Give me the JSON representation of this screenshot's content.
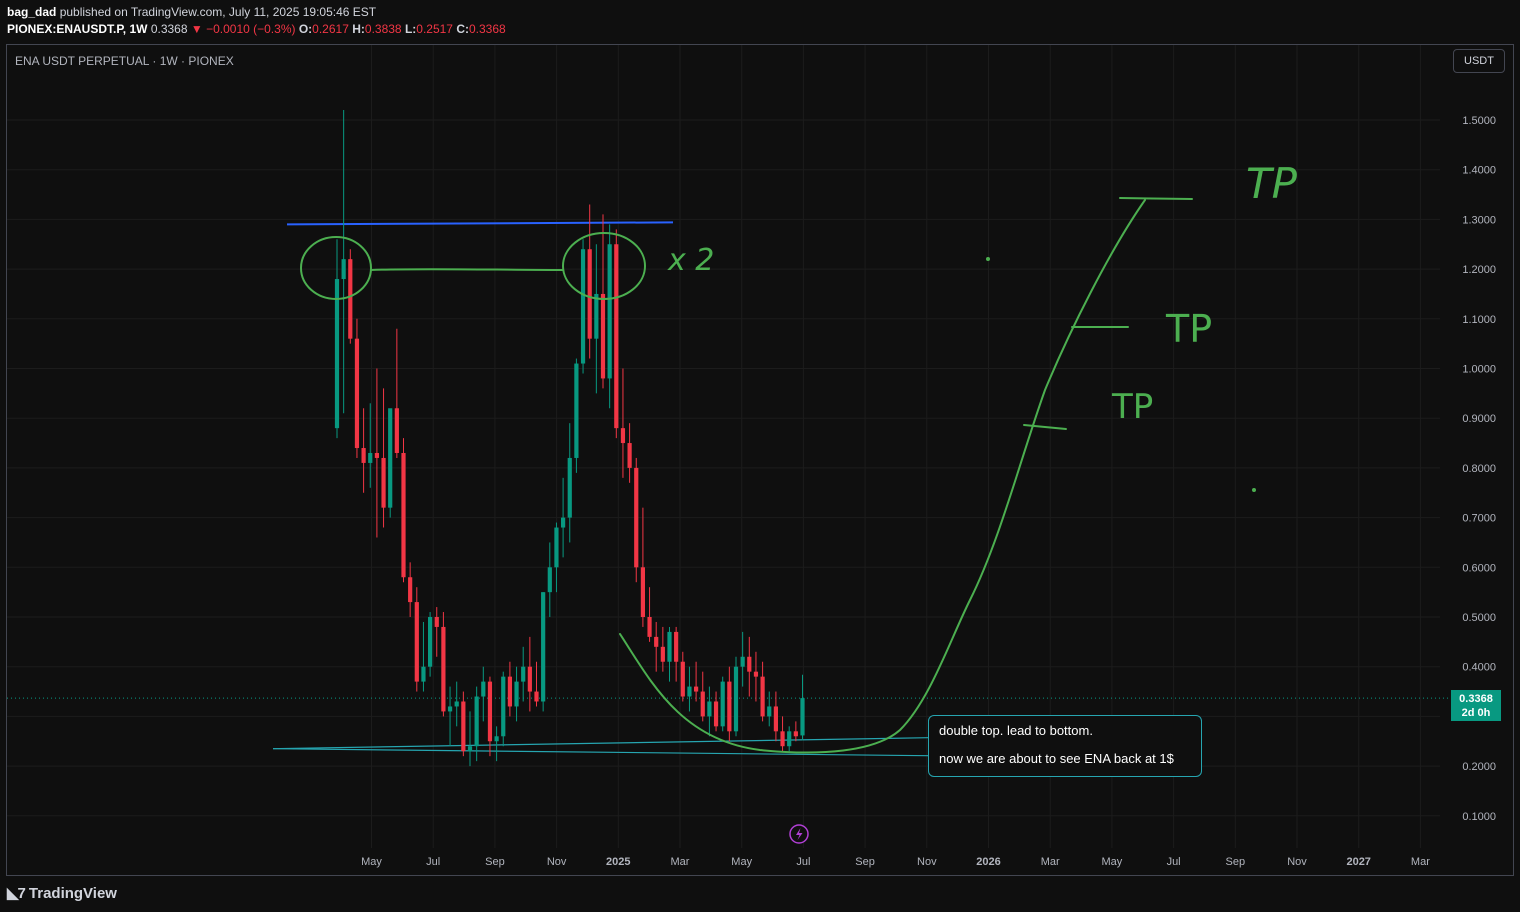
{
  "header": {
    "author": "bag_dad",
    "published": "published on TradingView.com, July 11, 2025 19:05:46 EST",
    "symbol": "PIONEX:ENAUSDT.P, 1W",
    "last": "0.3368",
    "change": "▼ −0.0010 (−0.3%)",
    "o_label": "O:",
    "o": "0.2617",
    "h_label": "H:",
    "h": "0.3838",
    "l_label": "L:",
    "l": "0.2517",
    "c_label": "C:",
    "c": "0.3368"
  },
  "chart_title": "ENA USDT PERPETUAL · 1W · PIONEX",
  "unit_button": "USDT",
  "price_tag": {
    "price": "0.3368",
    "countdown": "2d 0h"
  },
  "note": {
    "line1": "double top. lead to bottom.",
    "line2": "now we are about to see ENA back at 1$"
  },
  "drawings": {
    "x2_label": "x 2",
    "tp_labels": [
      "TP",
      "TP",
      "TP"
    ]
  },
  "footer": {
    "logo": "TradingView"
  },
  "colors": {
    "up": "#089981",
    "down": "#f23645",
    "background": "#0f0f0f",
    "grid": "#1c1c1c",
    "hand_drawn": "#4caf50",
    "resistance": "#2962ff",
    "support": "#26a5b0"
  },
  "chart_data": {
    "type": "candlestick",
    "title": "ENA USDT PERPETUAL · 1W · PIONEX",
    "y_ticks": [
      "0.1000",
      "0.2000",
      "0.3000",
      "0.4000",
      "0.5000",
      "0.6000",
      "0.7000",
      "0.8000",
      "0.9000",
      "1.0000",
      "1.1000",
      "1.2000",
      "1.3000",
      "1.4000",
      "1.5000"
    ],
    "x_ticks": [
      "May",
      "Jul",
      "Sep",
      "Nov",
      "2025",
      "Mar",
      "May",
      "Jul",
      "Sep",
      "Nov",
      "2026",
      "Mar",
      "May",
      "Jul",
      "Sep",
      "Nov",
      "2027",
      "Mar"
    ],
    "last_price": 0.3368,
    "grid": true,
    "resistance_level": 1.29,
    "support_level": 0.235,
    "candles": [
      {
        "o": 0.88,
        "h": 1.26,
        "l": 0.86,
        "c": 1.18
      },
      {
        "o": 1.18,
        "h": 1.52,
        "l": 0.91,
        "c": 1.22
      },
      {
        "o": 1.22,
        "h": 1.24,
        "l": 1.05,
        "c": 1.06
      },
      {
        "o": 1.06,
        "h": 1.1,
        "l": 0.82,
        "c": 0.84
      },
      {
        "o": 0.84,
        "h": 0.92,
        "l": 0.75,
        "c": 0.81
      },
      {
        "o": 0.81,
        "h": 0.93,
        "l": 0.76,
        "c": 0.83
      },
      {
        "o": 0.83,
        "h": 1.0,
        "l": 0.66,
        "c": 0.82
      },
      {
        "o": 0.82,
        "h": 0.96,
        "l": 0.68,
        "c": 0.72
      },
      {
        "o": 0.72,
        "h": 0.91,
        "l": 0.7,
        "c": 0.92
      },
      {
        "o": 0.92,
        "h": 1.08,
        "l": 0.82,
        "c": 0.83
      },
      {
        "o": 0.83,
        "h": 0.86,
        "l": 0.57,
        "c": 0.58
      },
      {
        "o": 0.58,
        "h": 0.61,
        "l": 0.5,
        "c": 0.53
      },
      {
        "o": 0.53,
        "h": 0.56,
        "l": 0.35,
        "c": 0.37
      },
      {
        "o": 0.37,
        "h": 0.49,
        "l": 0.35,
        "c": 0.4
      },
      {
        "o": 0.4,
        "h": 0.51,
        "l": 0.38,
        "c": 0.5
      },
      {
        "o": 0.5,
        "h": 0.52,
        "l": 0.42,
        "c": 0.48
      },
      {
        "o": 0.48,
        "h": 0.51,
        "l": 0.3,
        "c": 0.31
      },
      {
        "o": 0.31,
        "h": 0.36,
        "l": 0.24,
        "c": 0.32
      },
      {
        "o": 0.32,
        "h": 0.37,
        "l": 0.28,
        "c": 0.33
      },
      {
        "o": 0.33,
        "h": 0.35,
        "l": 0.22,
        "c": 0.23
      },
      {
        "o": 0.23,
        "h": 0.31,
        "l": 0.2,
        "c": 0.24
      },
      {
        "o": 0.24,
        "h": 0.36,
        "l": 0.21,
        "c": 0.34
      },
      {
        "o": 0.34,
        "h": 0.4,
        "l": 0.29,
        "c": 0.37
      },
      {
        "o": 0.37,
        "h": 0.38,
        "l": 0.22,
        "c": 0.25
      },
      {
        "o": 0.25,
        "h": 0.28,
        "l": 0.21,
        "c": 0.26
      },
      {
        "o": 0.26,
        "h": 0.39,
        "l": 0.24,
        "c": 0.38
      },
      {
        "o": 0.38,
        "h": 0.41,
        "l": 0.3,
        "c": 0.32
      },
      {
        "o": 0.32,
        "h": 0.4,
        "l": 0.29,
        "c": 0.37
      },
      {
        "o": 0.37,
        "h": 0.44,
        "l": 0.33,
        "c": 0.4
      },
      {
        "o": 0.4,
        "h": 0.46,
        "l": 0.31,
        "c": 0.35
      },
      {
        "o": 0.35,
        "h": 0.41,
        "l": 0.32,
        "c": 0.33
      },
      {
        "o": 0.33,
        "h": 0.55,
        "l": 0.31,
        "c": 0.55
      },
      {
        "o": 0.55,
        "h": 0.65,
        "l": 0.5,
        "c": 0.6
      },
      {
        "o": 0.6,
        "h": 0.69,
        "l": 0.55,
        "c": 0.68
      },
      {
        "o": 0.68,
        "h": 0.78,
        "l": 0.62,
        "c": 0.7
      },
      {
        "o": 0.7,
        "h": 0.89,
        "l": 0.65,
        "c": 0.82
      },
      {
        "o": 0.82,
        "h": 1.02,
        "l": 0.79,
        "c": 1.01
      },
      {
        "o": 1.01,
        "h": 1.26,
        "l": 0.99,
        "c": 1.24
      },
      {
        "o": 1.24,
        "h": 1.33,
        "l": 1.02,
        "c": 1.06
      },
      {
        "o": 1.06,
        "h": 1.25,
        "l": 0.95,
        "c": 1.15
      },
      {
        "o": 1.15,
        "h": 1.31,
        "l": 0.96,
        "c": 0.98
      },
      {
        "o": 0.98,
        "h": 1.29,
        "l": 0.92,
        "c": 1.25
      },
      {
        "o": 1.25,
        "h": 1.28,
        "l": 0.86,
        "c": 0.88
      },
      {
        "o": 0.88,
        "h": 1.0,
        "l": 0.78,
        "c": 0.85
      },
      {
        "o": 0.85,
        "h": 0.89,
        "l": 0.77,
        "c": 0.8
      },
      {
        "o": 0.8,
        "h": 0.82,
        "l": 0.57,
        "c": 0.6
      },
      {
        "o": 0.6,
        "h": 0.72,
        "l": 0.48,
        "c": 0.5
      },
      {
        "o": 0.5,
        "h": 0.56,
        "l": 0.45,
        "c": 0.46
      },
      {
        "o": 0.46,
        "h": 0.49,
        "l": 0.39,
        "c": 0.44
      },
      {
        "o": 0.44,
        "h": 0.48,
        "l": 0.39,
        "c": 0.41
      },
      {
        "o": 0.41,
        "h": 0.48,
        "l": 0.37,
        "c": 0.47
      },
      {
        "o": 0.47,
        "h": 0.48,
        "l": 0.37,
        "c": 0.41
      },
      {
        "o": 0.41,
        "h": 0.43,
        "l": 0.33,
        "c": 0.34
      },
      {
        "o": 0.34,
        "h": 0.4,
        "l": 0.31,
        "c": 0.36
      },
      {
        "o": 0.36,
        "h": 0.41,
        "l": 0.33,
        "c": 0.35
      },
      {
        "o": 0.35,
        "h": 0.39,
        "l": 0.29,
        "c": 0.3
      },
      {
        "o": 0.3,
        "h": 0.36,
        "l": 0.26,
        "c": 0.33
      },
      {
        "o": 0.33,
        "h": 0.35,
        "l": 0.27,
        "c": 0.28
      },
      {
        "o": 0.28,
        "h": 0.38,
        "l": 0.27,
        "c": 0.37
      },
      {
        "o": 0.37,
        "h": 0.4,
        "l": 0.25,
        "c": 0.27
      },
      {
        "o": 0.27,
        "h": 0.42,
        "l": 0.26,
        "c": 0.4
      },
      {
        "o": 0.4,
        "h": 0.47,
        "l": 0.36,
        "c": 0.42
      },
      {
        "o": 0.42,
        "h": 0.46,
        "l": 0.34,
        "c": 0.39
      },
      {
        "o": 0.39,
        "h": 0.43,
        "l": 0.33,
        "c": 0.38
      },
      {
        "o": 0.38,
        "h": 0.41,
        "l": 0.29,
        "c": 0.3
      },
      {
        "o": 0.3,
        "h": 0.35,
        "l": 0.28,
        "c": 0.32
      },
      {
        "o": 0.32,
        "h": 0.35,
        "l": 0.25,
        "c": 0.27
      },
      {
        "o": 0.27,
        "h": 0.3,
        "l": 0.23,
        "c": 0.24
      },
      {
        "o": 0.24,
        "h": 0.28,
        "l": 0.23,
        "c": 0.27
      },
      {
        "o": 0.27,
        "h": 0.29,
        "l": 0.25,
        "c": 0.26
      },
      {
        "o": 0.2617,
        "h": 0.3838,
        "l": 0.2517,
        "c": 0.3368
      }
    ]
  }
}
